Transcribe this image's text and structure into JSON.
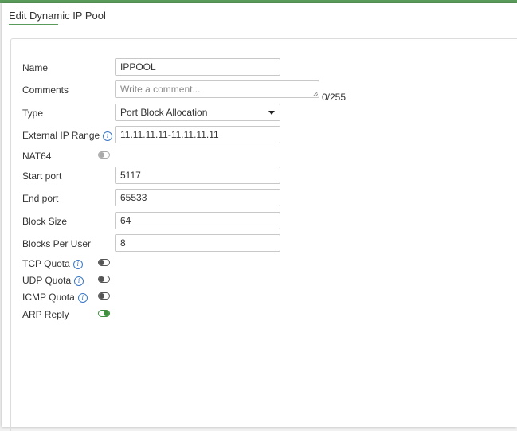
{
  "dialog": {
    "title": "Edit Dynamic IP Pool"
  },
  "form": {
    "name": {
      "label": "Name",
      "value": "IPPOOL"
    },
    "comments": {
      "label": "Comments",
      "placeholder": "Write a comment...",
      "counter": "0/255"
    },
    "type": {
      "label": "Type",
      "value": "Port Block Allocation"
    },
    "external_ip_range": {
      "label": "External IP Range",
      "value": "11.11.11.11-11.11.11.11"
    },
    "nat64": {
      "label": "NAT64",
      "enabled": false
    },
    "start_port": {
      "label": "Start port",
      "value": "5117"
    },
    "end_port": {
      "label": "End port",
      "value": "65533"
    },
    "block_size": {
      "label": "Block Size",
      "value": "64"
    },
    "blocks_per_user": {
      "label": "Blocks Per User",
      "value": "8"
    },
    "tcp_quota": {
      "label": "TCP Quota",
      "enabled": false
    },
    "udp_quota": {
      "label": "UDP Quota",
      "enabled": false
    },
    "icmp_quota": {
      "label": "ICMP Quota",
      "enabled": false
    },
    "arp_reply": {
      "label": "ARP Reply",
      "enabled": true
    }
  },
  "icons": {
    "info": "info-circle-icon",
    "dropdown": "caret-down-icon"
  },
  "colors": {
    "accent": "#5a9a5a",
    "toggle_on": "#3f8f3f",
    "info": "#3a78c8"
  }
}
